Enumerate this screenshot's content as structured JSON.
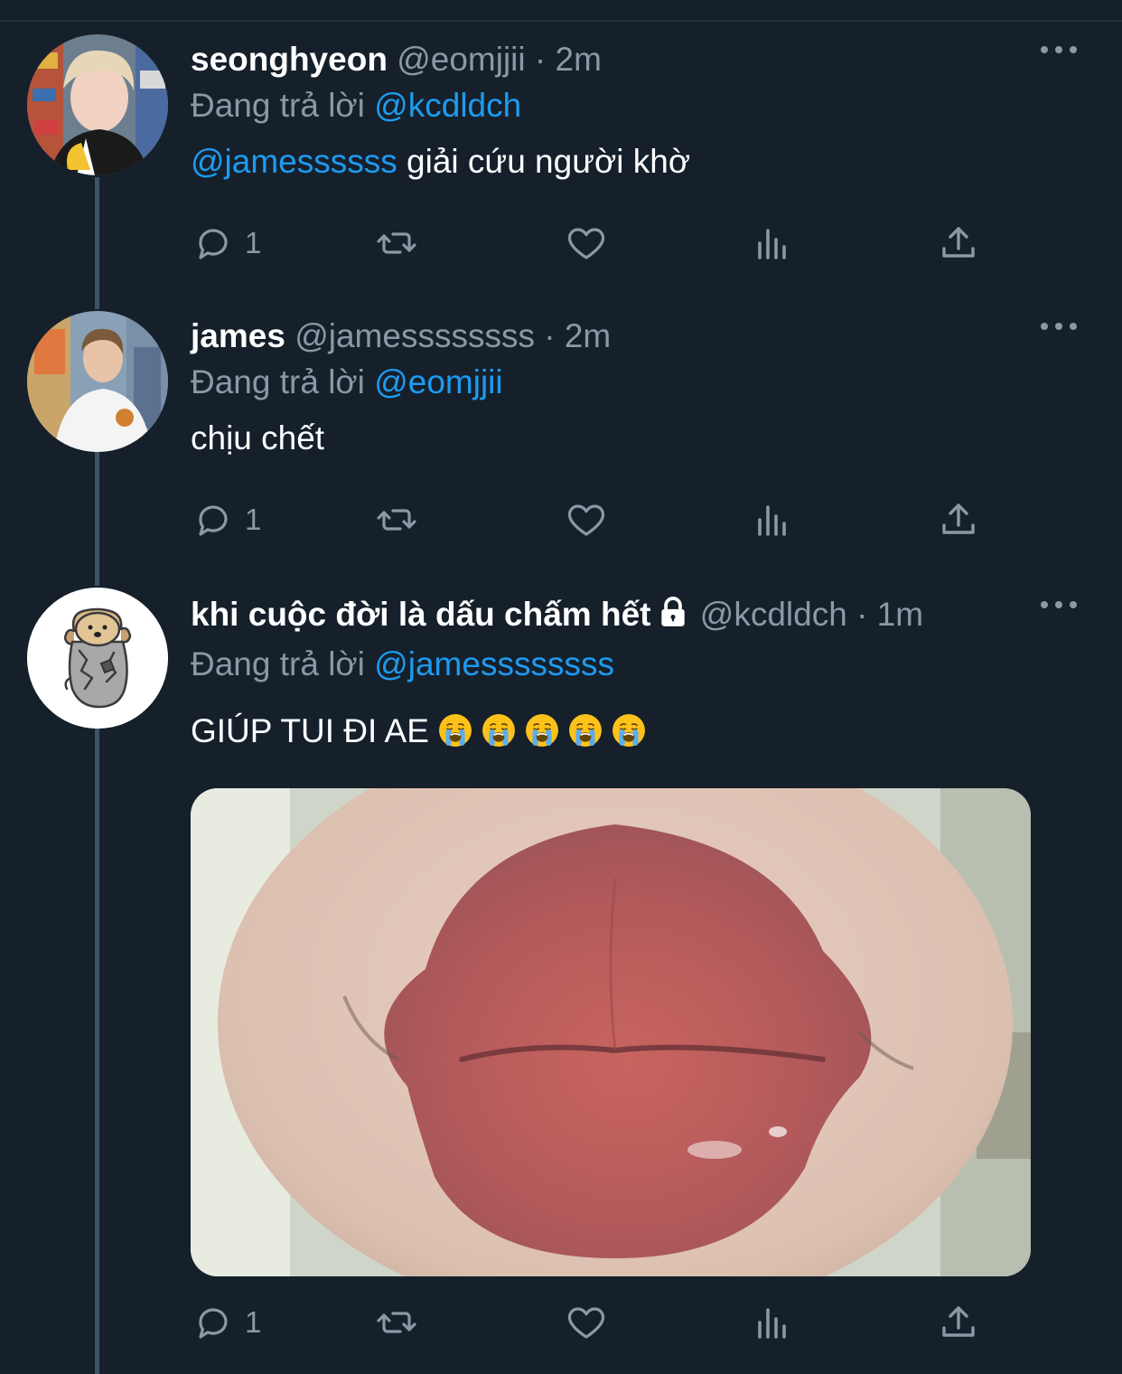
{
  "tweets": [
    {
      "name": "seonghyeon",
      "handle": "@eomjjii",
      "dot": "·",
      "time": "2m",
      "replying_label": "Đang trả lời",
      "replying_to": "@kcdldch",
      "mention": "@jamessssss",
      "text": " giải cứu người khờ",
      "reply_count": "1",
      "avatar": "avatar-photo-seonghyeon"
    },
    {
      "name": "james",
      "handle": "@jamessssssss",
      "dot": "·",
      "time": "2m",
      "replying_label": "Đang trả lời",
      "replying_to": "@eomjjii",
      "text": "chịu chết",
      "reply_count": "1",
      "avatar": "avatar-photo-james"
    },
    {
      "name": "khi cuộc đời là dấu chấm hết",
      "handle": "@kcdldch",
      "dot": "·",
      "time": "1m",
      "replying_label": "Đang trả lời",
      "replying_to": "@jamessssssss",
      "text": "GIÚP TUI ĐI AE",
      "emoji_count": 5,
      "emoji": "crying-face",
      "reply_count": "1",
      "locked": true,
      "avatar": "avatar-dog-drawing",
      "media": "lips-closeup-photo"
    }
  ],
  "colors": {
    "background": "#15202b",
    "text": "#ffffff",
    "secondary": "#8b98a5",
    "link": "#1d9bf0",
    "thread_line": "#3d5466"
  }
}
